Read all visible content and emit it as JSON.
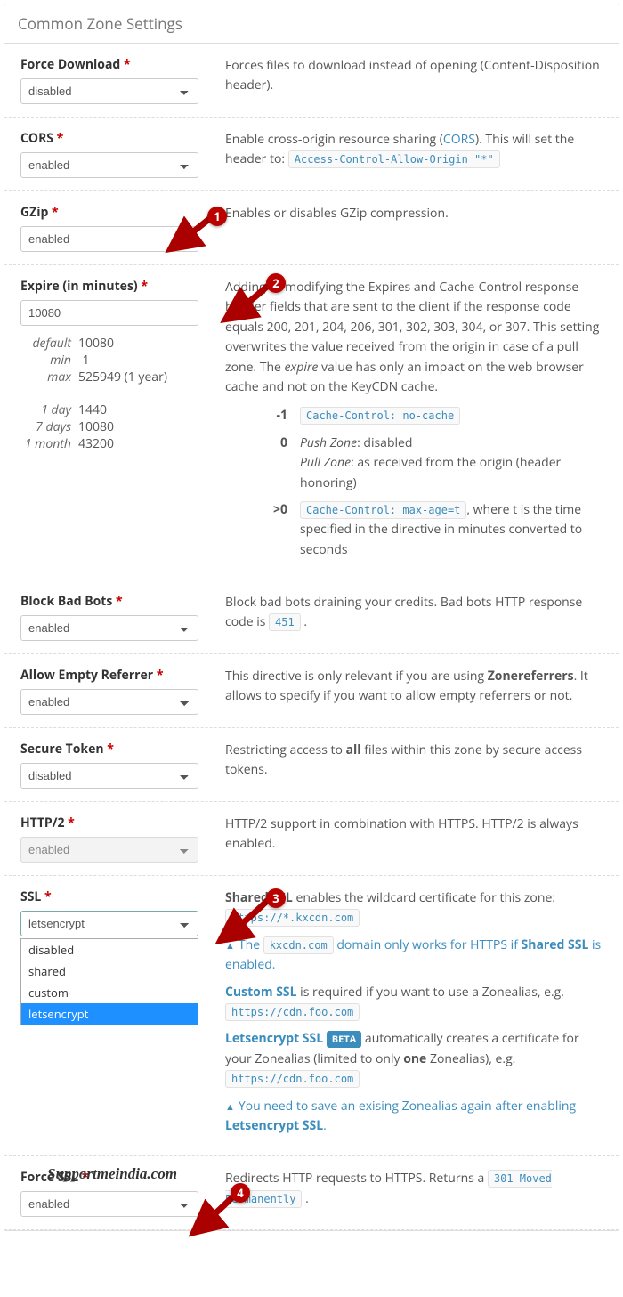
{
  "panel_title": "Common Zone Settings",
  "fields": {
    "force_download": {
      "label": "Force Download",
      "value": "disabled",
      "desc": "Forces files to download instead of opening (Content-Disposition header)."
    },
    "cors": {
      "label": "CORS",
      "value": "enabled",
      "desc_pre": "Enable cross-origin resource sharing (",
      "link": "CORS",
      "desc_post": "). This will set the header to:",
      "code": "Access-Control-Allow-Origin \"*\""
    },
    "gzip": {
      "label": "GZip",
      "value": "enabled",
      "desc": "Enables or disables GZip compression."
    },
    "expire": {
      "label": "Expire (in minutes)",
      "value": "10080",
      "desc": "Adding or modifying the Expires and Cache-Control response header fields that are sent to the client if the response code equals 200, 201, 204, 206, 301, 302, 303, 304, or 307. This setting overwrites the value received from the origin in case of a pull zone. The ",
      "desc_em": "expire",
      "desc2": " value has only an impact on the web browser cache and not on the KeyCDN cache.",
      "hints": [
        {
          "k": "default",
          "v": "10080"
        },
        {
          "k": "min",
          "v": "-1"
        },
        {
          "k": "max",
          "v": "525949 (1 year)"
        }
      ],
      "hints2": [
        {
          "k": "1 day",
          "v": "1440"
        },
        {
          "k": "7 days",
          "v": "10080"
        },
        {
          "k": "1 month",
          "v": "43200"
        }
      ],
      "cache_rows": [
        {
          "k": "-1",
          "code": "Cache-Control: no-cache",
          "text": ""
        },
        {
          "k": "0",
          "push": "Push Zone",
          "push_t": ": disabled",
          "pull": "Pull Zone",
          "pull_t": ": as received from the origin (header honoring)"
        },
        {
          "k": ">0",
          "code": "Cache-Control: max-age=t",
          "text": ", where t is the time specified in the directive in minutes converted to seconds"
        }
      ]
    },
    "block_bots": {
      "label": "Block Bad Bots",
      "value": "enabled",
      "desc": "Block bad bots draining your credits. Bad bots HTTP response code is ",
      "code": "451"
    },
    "empty_ref": {
      "label": "Allow Empty Referrer",
      "value": "enabled",
      "desc_pre": "This directive is only relevant if you are using ",
      "link": "Zonereferrers",
      "desc_post": ". It allows to specify if you want to allow empty referrers or not."
    },
    "secure_token": {
      "label": "Secure Token",
      "value": "disabled",
      "desc_pre": "Restricting access to ",
      "bold": "all",
      "desc_post": " files within this zone by secure access tokens."
    },
    "http2": {
      "label": "HTTP/2",
      "value": "enabled",
      "desc": "HTTP/2 support in combination with HTTPS. HTTP/2 is always enabled."
    },
    "ssl": {
      "label": "SSL",
      "value": "letsencrypt",
      "options": [
        "disabled",
        "shared",
        "custom",
        "letsencrypt"
      ],
      "shared_b": "Shared SSL",
      "shared_t": " enables the wildcard certificate for this zone:",
      "shared_code": "https://*.kxcdn.com",
      "warn1_pre": "The ",
      "warn1_code": "kxcdn.com",
      "warn1_mid": " domain only works for HTTPS if ",
      "warn1_b": "Shared SSL",
      "warn1_post": " is enabled.",
      "custom_b": "Custom SSL",
      "custom_t": " is required if you want to use a Zonealias, e.g.",
      "custom_code": "https://cdn.foo.com",
      "le_b": "Letsencrypt SSL",
      "beta": "BETA",
      "le_t": " automatically creates a certificate for your Zonealias (limited to only ",
      "le_one": "one",
      "le_t2": " Zonealias), e.g. ",
      "le_code": "https://cdn.foo.com",
      "warn2_pre": "You need to save an exising Zonealias again after enabling ",
      "warn2_b": "Letsencrypt SSL",
      "warn2_post": "."
    },
    "force_ssl": {
      "label": "Force SSL",
      "value": "enabled",
      "desc": "Redirects HTTP requests to HTTPS. Returns a ",
      "code": "301 Moved Permanently"
    }
  },
  "markers": {
    "1": "1",
    "2": "2",
    "3": "3",
    "4": "4"
  },
  "watermark": "Supportmeindia.com"
}
